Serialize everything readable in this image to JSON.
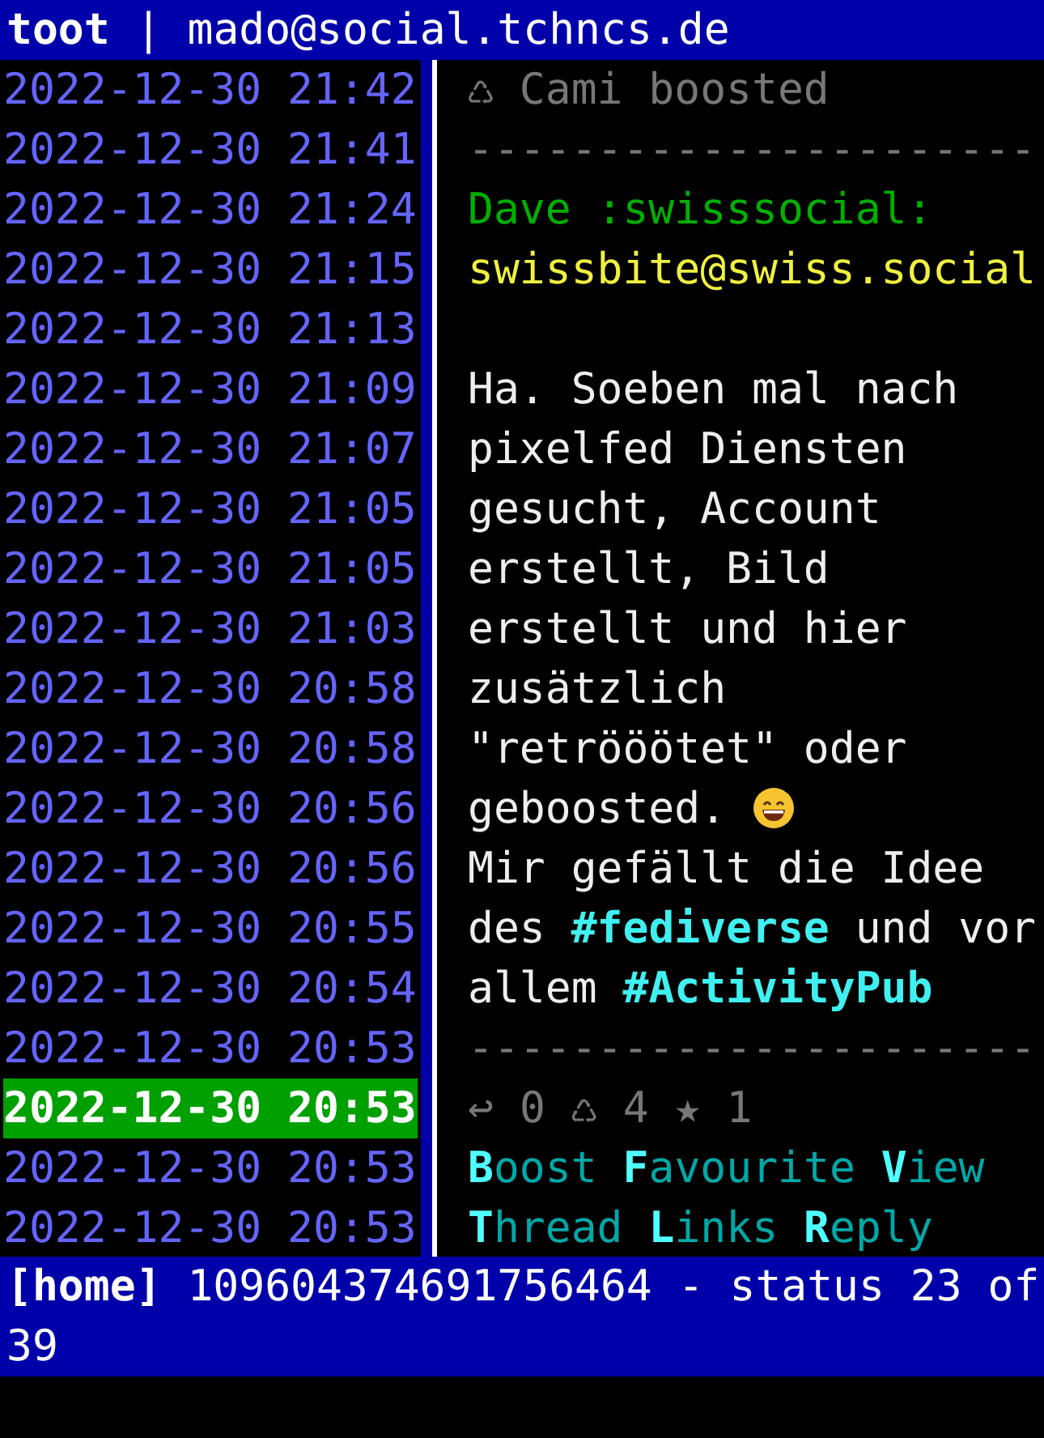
{
  "title_bar": {
    "app": "toot",
    "separator": "|",
    "account": "mado@social.tchncs.de"
  },
  "timeline": [
    {
      "time": "2022-12-30 21:42",
      "selected": false
    },
    {
      "time": "2022-12-30 21:41",
      "selected": false
    },
    {
      "time": "2022-12-30 21:24",
      "selected": false
    },
    {
      "time": "2022-12-30 21:15",
      "selected": false
    },
    {
      "time": "2022-12-30 21:13",
      "selected": false
    },
    {
      "time": "2022-12-30 21:09",
      "selected": false
    },
    {
      "time": "2022-12-30 21:07",
      "selected": false
    },
    {
      "time": "2022-12-30 21:05",
      "selected": false
    },
    {
      "time": "2022-12-30 21:05",
      "selected": false
    },
    {
      "time": "2022-12-30 21:03",
      "selected": false
    },
    {
      "time": "2022-12-30 20:58",
      "selected": false
    },
    {
      "time": "2022-12-30 20:58",
      "selected": false
    },
    {
      "time": "2022-12-30 20:56",
      "selected": false
    },
    {
      "time": "2022-12-30 20:56",
      "selected": false
    },
    {
      "time": "2022-12-30 20:55",
      "selected": false
    },
    {
      "time": "2022-12-30 20:54",
      "selected": false
    },
    {
      "time": "2022-12-30 20:53",
      "selected": false
    },
    {
      "time": "2022-12-30 20:53",
      "selected": true
    },
    {
      "time": "2022-12-30 20:53",
      "selected": false
    },
    {
      "time": "2022-12-30 20:53",
      "selected": false
    }
  ],
  "status": {
    "boosted_by": "♺ Cami boosted",
    "divider_top": "----------------------",
    "author_name": "Dave :swisssocial:",
    "author_handle": "swissbite@swiss.social",
    "body": [
      {
        "kind": "text",
        "text": "Ha. Soeben mal nach"
      },
      {
        "kind": "text",
        "text": "pixelfed Diensten"
      },
      {
        "kind": "text",
        "text": "gesucht, Account"
      },
      {
        "kind": "text",
        "text": "erstellt, Bild"
      },
      {
        "kind": "text",
        "text": "erstellt und hier"
      },
      {
        "kind": "text",
        "text": "zusätzlich"
      },
      {
        "kind": "text",
        "text": "\"retrööötet\" oder"
      },
      {
        "kind": "emoji",
        "text": "geboosted."
      },
      {
        "kind": "text",
        "text": "Mir gefällt die Idee"
      },
      {
        "kind": "text",
        "text": "des **#fediverse** und vor"
      },
      {
        "kind": "text",
        "text": "allem **#ActivityPub**"
      }
    ],
    "divider_bottom": "----------------------",
    "stats": [
      {
        "icon": "↩",
        "count": "0"
      },
      {
        "icon": "♺",
        "count": "4"
      },
      {
        "icon": "★",
        "count": "1"
      }
    ],
    "actions": [
      {
        "key": "B",
        "rest": "oost"
      },
      {
        "key": "F",
        "rest": "avourite"
      },
      {
        "key": "V",
        "rest": "iew"
      },
      {
        "key": "T",
        "rest": "hread"
      },
      {
        "key": "L",
        "rest": "inks"
      },
      {
        "key": "R",
        "rest": "eply"
      }
    ]
  },
  "status_bar": {
    "timeline": "[home]",
    "info": "109604374691756464 - status 23 of 39"
  }
}
